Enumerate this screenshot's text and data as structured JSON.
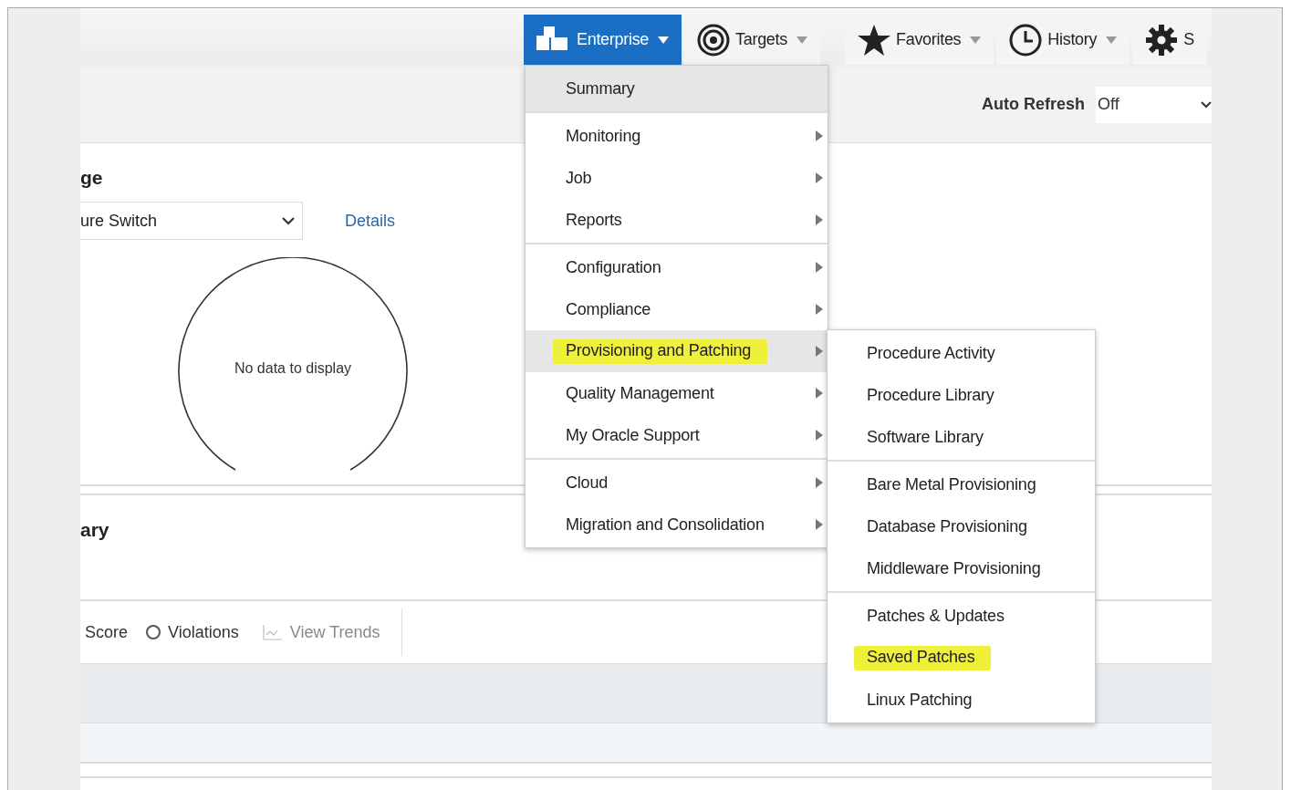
{
  "nav": [
    {
      "label": "Enterprise",
      "kind": "icon-blocks",
      "selected": true
    },
    {
      "label": "Targets",
      "kind": "icon-target",
      "selected": false
    },
    {
      "label": "Favorites",
      "kind": "icon-star",
      "selected": false
    },
    {
      "label": "History",
      "kind": "icon-clock",
      "selected": false
    },
    {
      "label": "S",
      "kind": "icon-gear",
      "selected": false
    }
  ],
  "header": {
    "auto_refresh_label": "Auto Refresh",
    "auto_refresh_value": "Off"
  },
  "panel": {
    "title": "ge",
    "select_value": "ure Switch",
    "details_link": "Details",
    "gauge_text": "No data to display"
  },
  "summary": {
    "title": "ary"
  },
  "toolbar": {
    "score": "Score",
    "violations": {
      "label": "Violations",
      "selected": false
    },
    "trends": {
      "label": "View Trends",
      "disabled": true
    }
  },
  "menu": [
    [
      {
        "label": "Summary",
        "kind": "link",
        "selected": true,
        "highlighted": false
      }
    ],
    [
      {
        "label": "Monitoring",
        "kind": "submenu",
        "selected": false,
        "highlighted": false
      },
      {
        "label": "Job",
        "kind": "submenu",
        "selected": false,
        "highlighted": false
      },
      {
        "label": "Reports",
        "kind": "submenu",
        "selected": false,
        "highlighted": false
      }
    ],
    [
      {
        "label": "Configuration",
        "kind": "submenu",
        "selected": false,
        "highlighted": false
      },
      {
        "label": "Compliance",
        "kind": "submenu",
        "selected": false,
        "highlighted": false
      },
      {
        "label": "Provisioning and Patching",
        "kind": "submenu",
        "selected": true,
        "highlighted": true
      },
      {
        "label": "Quality Management",
        "kind": "submenu",
        "selected": false,
        "highlighted": false
      },
      {
        "label": "My Oracle Support",
        "kind": "submenu",
        "selected": false,
        "highlighted": false
      }
    ],
    [
      {
        "label": "Cloud",
        "kind": "submenu",
        "selected": false,
        "highlighted": false
      },
      {
        "label": "Migration and Consolidation",
        "kind": "submenu",
        "selected": false,
        "highlighted": false
      }
    ]
  ],
  "submenu": [
    [
      {
        "label": "Procedure Activity",
        "highlighted": false
      },
      {
        "label": "Procedure Library",
        "highlighted": false
      },
      {
        "label": "Software Library",
        "highlighted": false
      }
    ],
    [
      {
        "label": "Bare Metal Provisioning",
        "highlighted": false
      },
      {
        "label": "Database Provisioning",
        "highlighted": false
      },
      {
        "label": "Middleware Provisioning",
        "highlighted": false
      }
    ],
    [
      {
        "label": "Patches & Updates",
        "highlighted": false
      },
      {
        "label": "Saved Patches",
        "highlighted": true
      },
      {
        "label": "Linux Patching",
        "highlighted": false
      }
    ]
  ]
}
